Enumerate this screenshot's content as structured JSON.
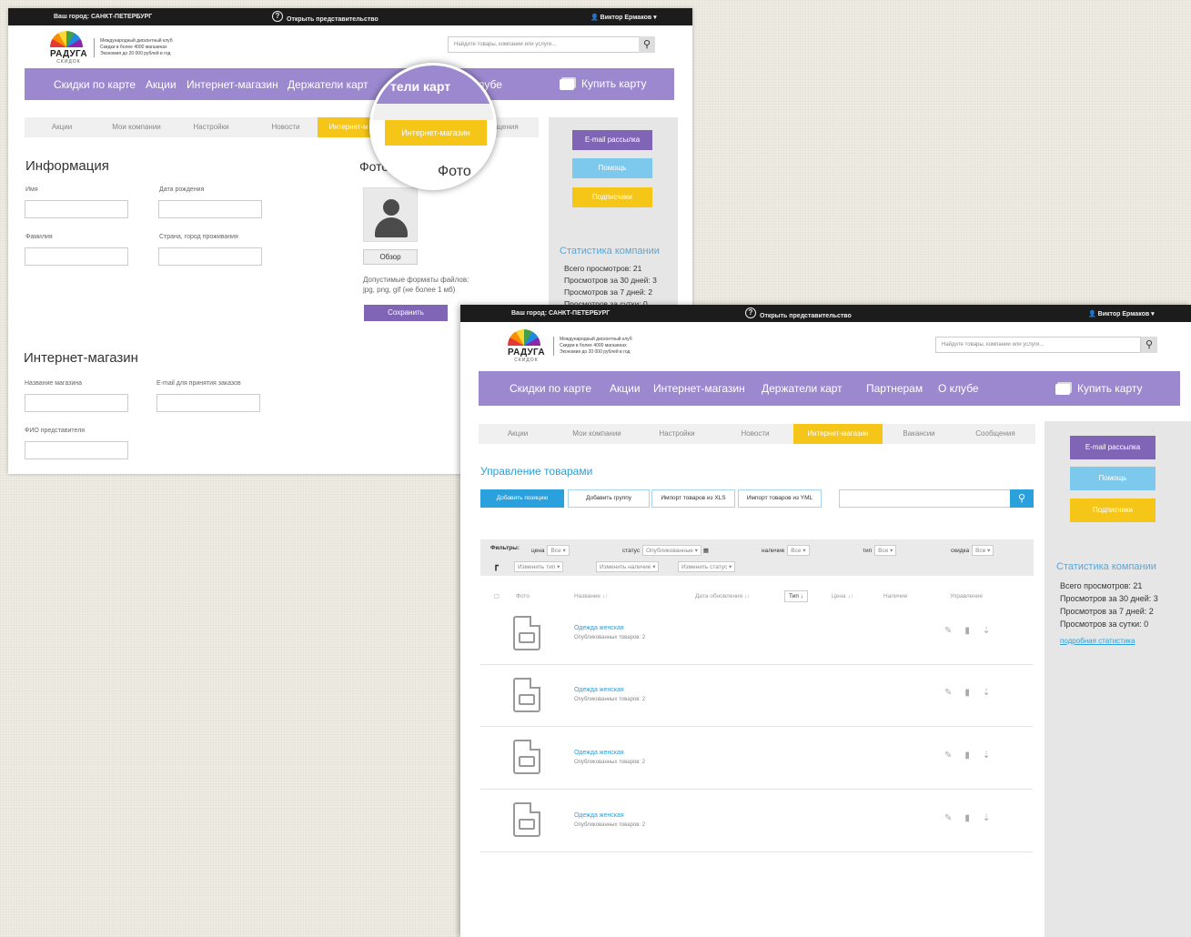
{
  "topbar": {
    "city": "Ваш город: САНКТ-ПЕТЕРБУРГ",
    "open": "Открыть представительство",
    "user": "Виктор Ермаков"
  },
  "logo": {
    "brand": "РАДУГА",
    "sub": "СКИДОК",
    "tagline": [
      "Международный дисконтный клуб",
      "Скидки в более 4000 магазинах",
      "Экономия до 20 000 рублей в год"
    ]
  },
  "search_placeholder": "Найдите товары, компании или услуги...",
  "menu_top": [
    "Скидки по карте",
    "Акции",
    "Интернет-магазин",
    "Держатели карт",
    "тели карт",
    "клубе"
  ],
  "menu": [
    "Скидки по карте",
    "Акции",
    "Интернет-магазин",
    "Держатели карт",
    "Партнерам",
    "О клубе"
  ],
  "buy": "Купить карту",
  "tabs": [
    "Акции",
    "Мои компании",
    "Настройки",
    "Новости",
    "Интернет-магазин",
    "Вакансии",
    "Сообщения"
  ],
  "tabs_top": [
    "Акции",
    "Мои компании",
    "Настройки",
    "Новости",
    "Интернет-м",
    "Сообщения"
  ],
  "sidebar": {
    "mail": "E-mail рассылка",
    "help": "Помощь",
    "sub": "Подписчики",
    "stats_title": "Статистика компании",
    "stats": [
      "Всего просмотров:  21",
      "Просмотров за 30 дней: 3",
      "Просмотров за 7 дней: 2",
      "Просмотров за сутки: 0"
    ],
    "link": "подробная статистика"
  },
  "info": {
    "title": "Информация",
    "name": "Имя",
    "birth": "Дата рождения",
    "surname": "Фамилия",
    "country": "Страна, город проживания",
    "photo": "Фото",
    "photo_mag": "Фото",
    "browse": "Обзор",
    "formats": [
      "Допустимые форматы файлов:",
      "jpg, png, gif (не более 1 мб)"
    ],
    "save": "Сохранить"
  },
  "shop": {
    "title": "Интернет-магазин",
    "name": "Название магазина",
    "email": "E-mail для принятия заказов",
    "fio": "ФИО представителя"
  },
  "magnifier": {
    "menu": "тели карт",
    "tab": "Интернет-магазин"
  },
  "goods": {
    "title": "Управление товарами",
    "add": "Добавить позицию",
    "group": "Добавить группу",
    "xls": "Импорт товаров из XLS",
    "yml": "Импорт товаров из YML"
  },
  "filters": {
    "label": "Фильтры:",
    "price": "цена",
    "all": "Все",
    "status": "статус",
    "published": "Опубликованные",
    "avail": "наличие",
    "type": "тип",
    "disc": "скидка",
    "chtype": "Изменить тип",
    "chavail": "Изменить наличие",
    "chstatus": "Изменить статус"
  },
  "columns": [
    "Фото",
    "Название",
    "Дата обновления",
    "Тип",
    "Цена",
    "Наличие",
    "Управление"
  ],
  "rows": [
    {
      "name": "Одежда женская",
      "sub": "Опубликованных товаров: 2"
    },
    {
      "name": "Одежда женская",
      "sub": "Опубликованных товаров: 2"
    },
    {
      "name": "Одежда женская",
      "sub": "Опубликованных товаров: 2"
    },
    {
      "name": "Одежда женская",
      "sub": "Опубликованных товаров: 2"
    }
  ],
  "icons": [
    "question-icon",
    "user-icon",
    "search-icon",
    "card-icon",
    "pencil-icon",
    "trash-icon",
    "arrow-icon",
    "file-image-icon"
  ]
}
